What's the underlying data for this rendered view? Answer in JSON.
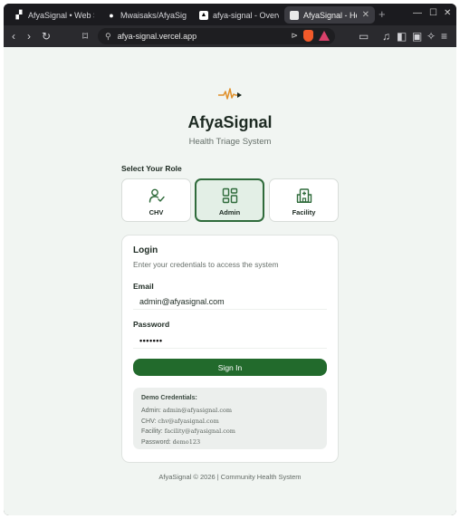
{
  "browser": {
    "tabs": [
      {
        "label": "AfyaSignal • Web S",
        "active": false
      },
      {
        "label": "Mwaisaks/AfyaSignal",
        "active": false
      },
      {
        "label": "afya-signal - Overview",
        "active": false
      },
      {
        "label": "AfyaSignal - Heal",
        "active": true
      }
    ],
    "new_tab": "+",
    "url": "afya-signal.vercel.app"
  },
  "app": {
    "title": "AfyaSignal",
    "subtitle": "Health Triage System",
    "role_heading": "Select Your Role",
    "roles": [
      {
        "label": "CHV",
        "icon": "user-check-icon",
        "selected": false
      },
      {
        "label": "Admin",
        "icon": "dashboard-grid-icon",
        "selected": true
      },
      {
        "label": "Facility",
        "icon": "hospital-building-icon",
        "selected": false
      }
    ],
    "accent_color": "#226a2c"
  },
  "login": {
    "title": "Login",
    "subtitle": "Enter your credentials to access the system",
    "email_label": "Email",
    "email_value": "admin@afyasignal.com",
    "password_label": "Password",
    "password_masked": "•••••••",
    "signin_label": "Sign In",
    "demo": {
      "title": "Demo Credentials:",
      "lines": [
        {
          "key": "Admin:",
          "value": "admin@afyasignal.com"
        },
        {
          "key": "CHV:",
          "value": "chv@afyasignal.com"
        },
        {
          "key": "Facility:",
          "value": "facility@afyasignal.com"
        },
        {
          "key": "Password:",
          "value": "demo123"
        }
      ]
    }
  },
  "footer": "AfyaSignal © 2026 | Community Health System"
}
